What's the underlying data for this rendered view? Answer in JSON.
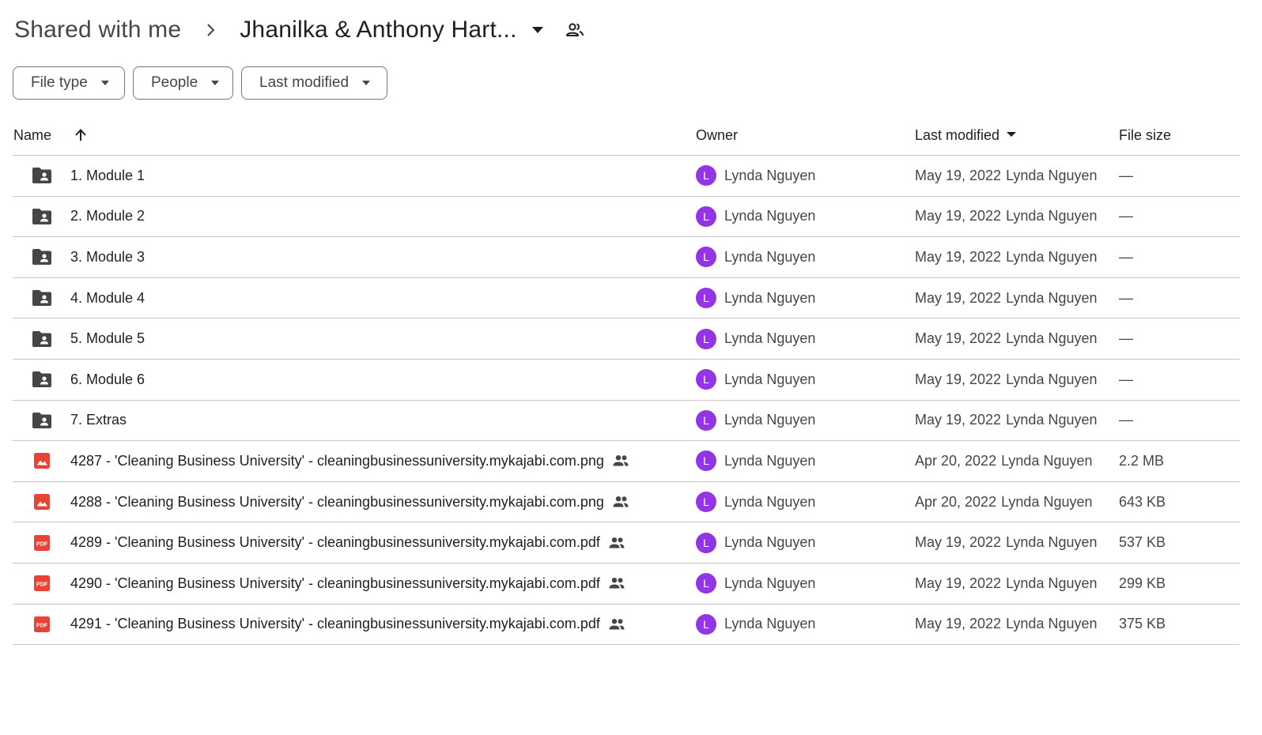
{
  "breadcrumb": {
    "root": "Shared with me",
    "current": "Jhanilka & Anthony Hart..."
  },
  "filters": [
    {
      "label": "File type"
    },
    {
      "label": "People"
    },
    {
      "label": "Last modified"
    }
  ],
  "columns": {
    "name": "Name",
    "owner": "Owner",
    "last_modified": "Last modified",
    "file_size": "File size"
  },
  "colors": {
    "avatar": "#9334e6",
    "folder": "#444746",
    "file_red": "#ea4335"
  },
  "rows": [
    {
      "icon": "shared-folder-icon",
      "name": "1. Module 1",
      "shared": false,
      "owner_initial": "L",
      "owner": "Lynda Nguyen",
      "date": "May 19, 2022",
      "modified_by": "Lynda Nguyen",
      "size": "—"
    },
    {
      "icon": "shared-folder-icon",
      "name": "2. Module 2",
      "shared": false,
      "owner_initial": "L",
      "owner": "Lynda Nguyen",
      "date": "May 19, 2022",
      "modified_by": "Lynda Nguyen",
      "size": "—"
    },
    {
      "icon": "shared-folder-icon",
      "name": "3. Module 3",
      "shared": false,
      "owner_initial": "L",
      "owner": "Lynda Nguyen",
      "date": "May 19, 2022",
      "modified_by": "Lynda Nguyen",
      "size": "—"
    },
    {
      "icon": "shared-folder-icon",
      "name": "4. Module 4",
      "shared": false,
      "owner_initial": "L",
      "owner": "Lynda Nguyen",
      "date": "May 19, 2022",
      "modified_by": "Lynda Nguyen",
      "size": "—"
    },
    {
      "icon": "shared-folder-icon",
      "name": "5. Module 5",
      "shared": false,
      "owner_initial": "L",
      "owner": "Lynda Nguyen",
      "date": "May 19, 2022",
      "modified_by": "Lynda Nguyen",
      "size": "—"
    },
    {
      "icon": "shared-folder-icon",
      "name": "6. Module 6",
      "shared": false,
      "owner_initial": "L",
      "owner": "Lynda Nguyen",
      "date": "May 19, 2022",
      "modified_by": "Lynda Nguyen",
      "size": "—"
    },
    {
      "icon": "shared-folder-icon",
      "name": "7. Extras",
      "shared": false,
      "owner_initial": "L",
      "owner": "Lynda Nguyen",
      "date": "May 19, 2022",
      "modified_by": "Lynda Nguyen",
      "size": "—"
    },
    {
      "icon": "image-file-icon",
      "name": "4287 - 'Cleaning Business University' - cleaningbusinessuniversity.mykajabi.com.png",
      "shared": true,
      "owner_initial": "L",
      "owner": "Lynda Nguyen",
      "date": "Apr 20, 2022",
      "modified_by": "Lynda Nguyen",
      "size": "2.2 MB"
    },
    {
      "icon": "image-file-icon",
      "name": "4288 - 'Cleaning Business University' - cleaningbusinessuniversity.mykajabi.com.png",
      "shared": true,
      "owner_initial": "L",
      "owner": "Lynda Nguyen",
      "date": "Apr 20, 2022",
      "modified_by": "Lynda Nguyen",
      "size": "643 KB"
    },
    {
      "icon": "pdf-file-icon",
      "name": "4289 - 'Cleaning Business University' - cleaningbusinessuniversity.mykajabi.com.pdf",
      "shared": true,
      "owner_initial": "L",
      "owner": "Lynda Nguyen",
      "date": "May 19, 2022",
      "modified_by": "Lynda Nguyen",
      "size": "537 KB"
    },
    {
      "icon": "pdf-file-icon",
      "name": "4290 - 'Cleaning Business University' - cleaningbusinessuniversity.mykajabi.com.pdf",
      "shared": true,
      "owner_initial": "L",
      "owner": "Lynda Nguyen",
      "date": "May 19, 2022",
      "modified_by": "Lynda Nguyen",
      "size": "299 KB"
    },
    {
      "icon": "pdf-file-icon",
      "name": "4291 - 'Cleaning Business University' - cleaningbusinessuniversity.mykajabi.com.pdf",
      "shared": true,
      "owner_initial": "L",
      "owner": "Lynda Nguyen",
      "date": "May 19, 2022",
      "modified_by": "Lynda Nguyen",
      "size": "375 KB"
    }
  ]
}
